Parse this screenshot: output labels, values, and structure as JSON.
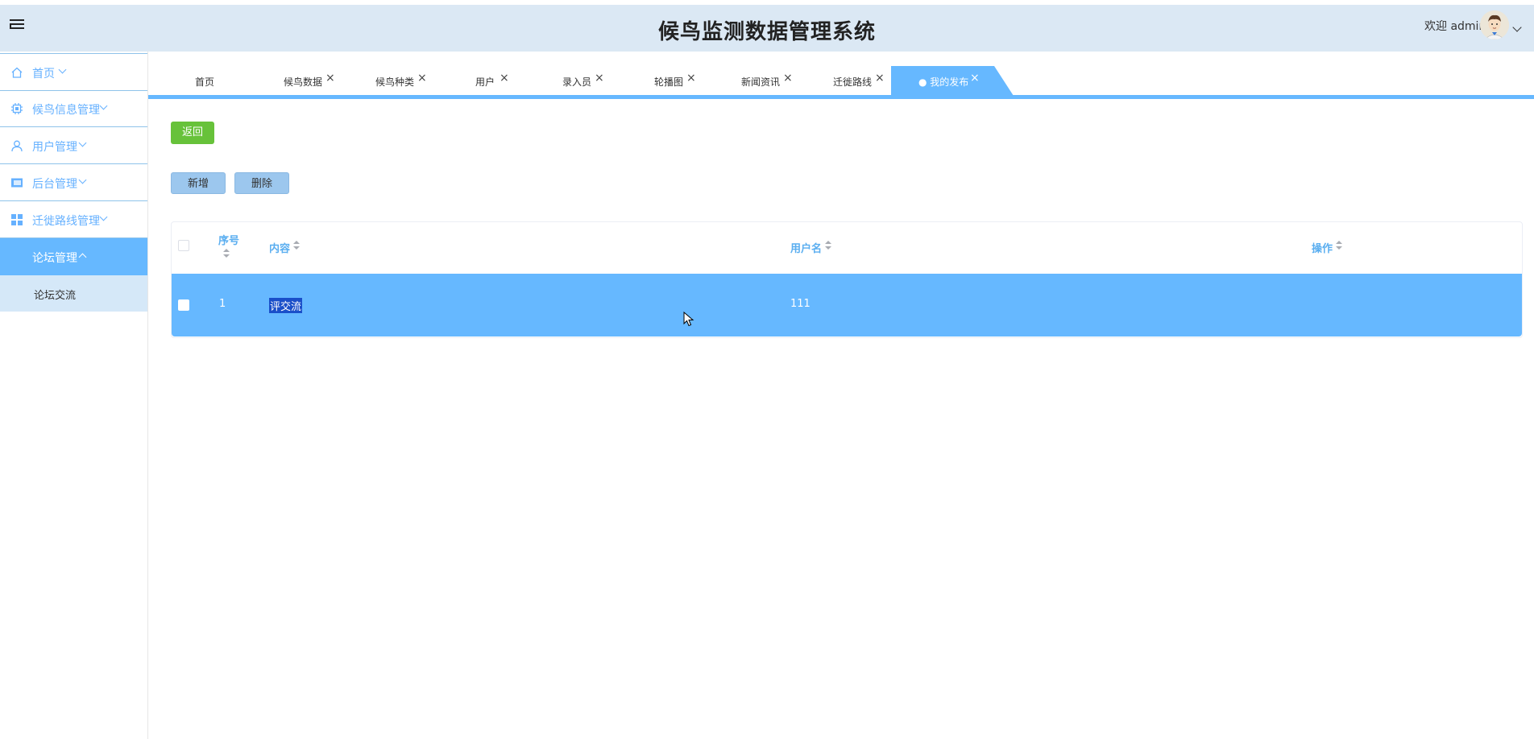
{
  "header": {
    "title": "候鸟监测数据管理系统",
    "welcome": "欢迎 admin"
  },
  "sidebar": {
    "items": [
      {
        "label": "首页",
        "icon": "home-icon"
      },
      {
        "label": "候鸟信息管理",
        "icon": "chip-icon"
      },
      {
        "label": "用户管理",
        "icon": "user-icon"
      },
      {
        "label": "后台管理",
        "icon": "panel-icon"
      },
      {
        "label": "迁徙路线管理",
        "icon": "grid-icon"
      },
      {
        "label": "论坛管理",
        "icon": ""
      }
    ],
    "sub_items": [
      {
        "label": "论坛交流"
      }
    ]
  },
  "tabs": [
    {
      "label": "首页",
      "closable": false
    },
    {
      "label": "候鸟数据",
      "closable": true
    },
    {
      "label": "候鸟种类",
      "closable": true
    },
    {
      "label": "用户",
      "closable": true
    },
    {
      "label": "录入员",
      "closable": true
    },
    {
      "label": "轮播图",
      "closable": true
    },
    {
      "label": "新闻资讯",
      "closable": true
    },
    {
      "label": "迁徙路线",
      "closable": true
    },
    {
      "label": "● 我的发布",
      "closable": true,
      "active": true
    }
  ],
  "tab_close_symbol": "×",
  "actions": {
    "back": "返回",
    "add": "新增",
    "delete": "删除"
  },
  "table": {
    "columns": [
      "序号",
      "内容",
      "用户名",
      "操作"
    ],
    "rows": [
      {
        "index": "1",
        "content": "评交流",
        "username": "111",
        "operation": ""
      }
    ]
  },
  "colors": {
    "header_bg": "#dbe8f4",
    "accent": "#66b8ff",
    "back_button": "#67c23a"
  }
}
